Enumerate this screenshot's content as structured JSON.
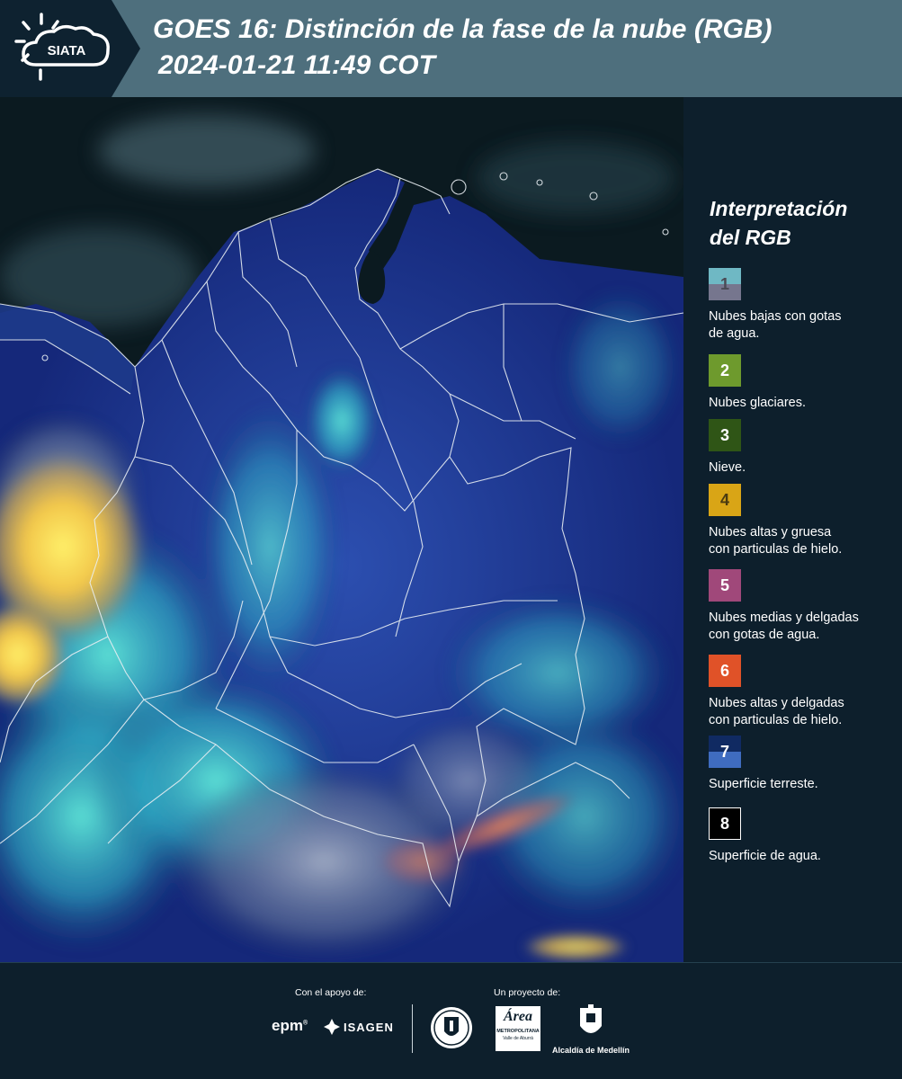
{
  "header": {
    "logo_text": "SIATA",
    "title": "GOES 16: Distinción de la fase de la nube (RGB)",
    "datetime": "2024-01-21 11:49 COT"
  },
  "legend": {
    "title_line1": "Interpretación",
    "title_line2": "del RGB",
    "items": [
      {
        "number": "1",
        "description_line1": "Nubes bajas con gotas",
        "description_line2": "de agua.",
        "color_top": "#6fb8c4",
        "color_bottom": "#76768e",
        "number_color": "#4a4a55"
      },
      {
        "number": "2",
        "description_line1": "Nubes glaciares.",
        "description_line2": "",
        "color_top": "#6e9a2d",
        "color_bottom": "#6e9a2d",
        "number_color": "#ffffff"
      },
      {
        "number": "3",
        "description_line1": "Nieve.",
        "description_line2": "",
        "color_top": "#2f5516",
        "color_bottom": "#2f5516",
        "number_color": "#ffffff"
      },
      {
        "number": "4",
        "description_line1": "Nubes altas y gruesa",
        "description_line2": "con particulas de hielo.",
        "color_top": "#d9a516",
        "color_bottom": "#d9a516",
        "number_color": "#4a3a10"
      },
      {
        "number": "5",
        "description_line1": "Nubes medias y delgadas",
        "description_line2": "con gotas de agua.",
        "color_top": "#a0487a",
        "color_bottom": "#a0487a",
        "number_color": "#ffffff"
      },
      {
        "number": "6",
        "description_line1": "Nubes altas y delgadas",
        "description_line2": "con particulas de hielo.",
        "color_top": "#e05228",
        "color_bottom": "#e05228",
        "number_color": "#ffffff"
      },
      {
        "number": "7",
        "description_line1": "Superficie terreste.",
        "description_line2": "",
        "color_top": "#102a62",
        "color_bottom": "#3f6cc0",
        "number_color": "#ffffff"
      },
      {
        "number": "8",
        "description_line1": "Superficie de agua.",
        "description_line2": "",
        "color_top": "#000000",
        "color_bottom": "#000000",
        "number_color": "#ffffff"
      }
    ]
  },
  "footer": {
    "support_caption": "Con el apoyo de:",
    "project_caption": "Un proyecto de:",
    "epm_logo_text": "epm",
    "isagen_logo_text": "ISAGEN",
    "area_logo_text": "Área",
    "area_logo_subtext": "METROPOLITANA",
    "area_logo_subtext2": "Valle de Aburrá",
    "alcaldia_text": "Alcaldía de Medellín"
  }
}
